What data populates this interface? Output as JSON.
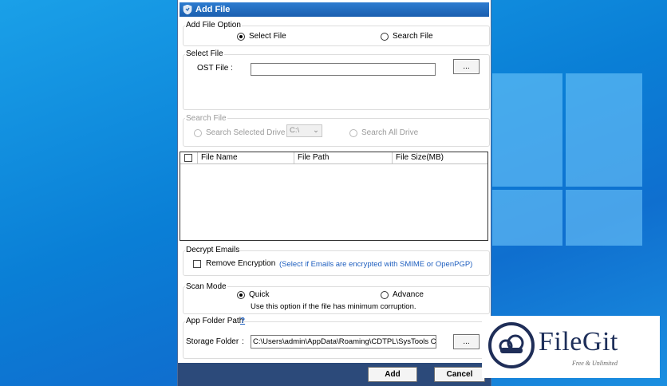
{
  "dialog": {
    "title": "Add File",
    "add_file_option": {
      "label": "Add File Option",
      "select_file": "Select File",
      "search_file": "Search File",
      "selected": "select_file"
    },
    "select_file": {
      "label": "Select File",
      "ost_label": "OST File :",
      "ost_value": "",
      "browse_label": "..."
    },
    "search_file": {
      "label": "Search File",
      "search_selected_drive": "Search Selected Drive",
      "drive_value": "C:\\",
      "search_all_drive": "Search All Drive"
    },
    "file_grid": {
      "columns": [
        "File Name",
        "File Path",
        "File Size(MB)"
      ]
    },
    "decrypt": {
      "label": "Decrypt Emails",
      "remove_encryption": "Remove Encryption",
      "hint": "(Select if Emails are encrypted with SMIME or OpenPGP)"
    },
    "scan_mode": {
      "label": "Scan Mode",
      "quick": "Quick",
      "advance": "Advance",
      "selected": "quick",
      "note": "Use this option if the file has minimum corruption."
    },
    "app_folder": {
      "label": "App Folder Path",
      "help": "?",
      "storage_label": "Storage Folder",
      "colon": ":",
      "storage_value": "C:\\Users\\admin\\AppData\\Roaming\\CDTPL\\SysTools C",
      "browse_label": "..."
    },
    "buttons": {
      "add": "Add",
      "cancel": "Cancel"
    }
  },
  "watermark": {
    "brand": "FileGit",
    "tagline": "Free & Unlimited",
    "icon": "cloud-icon"
  },
  "colors": {
    "desktop_blue": "#0a7fd6",
    "titlebar": "#1a5faf",
    "hint_blue": "#1f5fbf",
    "brand_navy": "#1e2f5a"
  }
}
